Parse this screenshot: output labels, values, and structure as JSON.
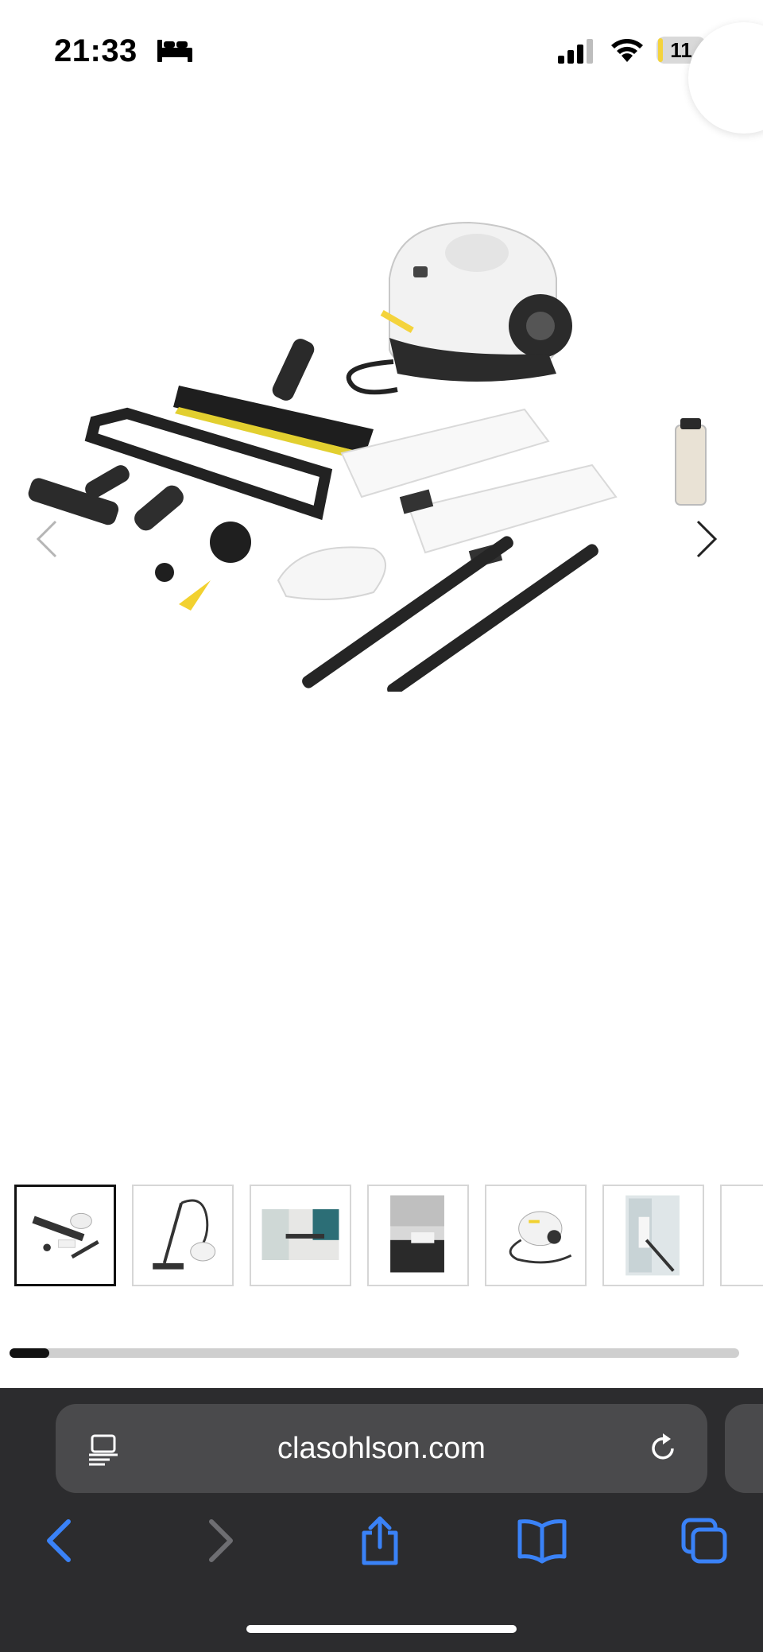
{
  "status_bar": {
    "time": "21:33",
    "battery_level": "11",
    "battery_fraction": 0.11
  },
  "gallery": {
    "main_image_alt": "Kärcher steam cleaner with accessories",
    "thumbnail_count": 7,
    "selected_index": 0,
    "scroll_progress": 0.055
  },
  "browser": {
    "url": "clasohlson.com"
  },
  "colors": {
    "browser_bar": "#2c2c2e",
    "url_field": "#4a4a4c",
    "accent": "#3a82f7",
    "battery": "#f4d33c"
  }
}
